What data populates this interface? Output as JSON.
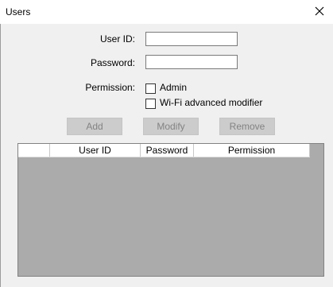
{
  "window": {
    "title": "Users"
  },
  "form": {
    "user_id_label": "User ID:",
    "password_label": "Password:",
    "permission_label": "Permission:",
    "user_id_value": "",
    "password_value": "",
    "permissions": [
      {
        "label": "Admin",
        "checked": false
      },
      {
        "label": "Wi-Fi advanced modifier",
        "checked": false
      }
    ]
  },
  "buttons": {
    "add": "Add",
    "modify": "Modify",
    "remove": "Remove"
  },
  "table": {
    "columns": [
      "User ID",
      "Password",
      "Permission"
    ],
    "rows": []
  },
  "icons": {
    "close": "close-icon"
  }
}
